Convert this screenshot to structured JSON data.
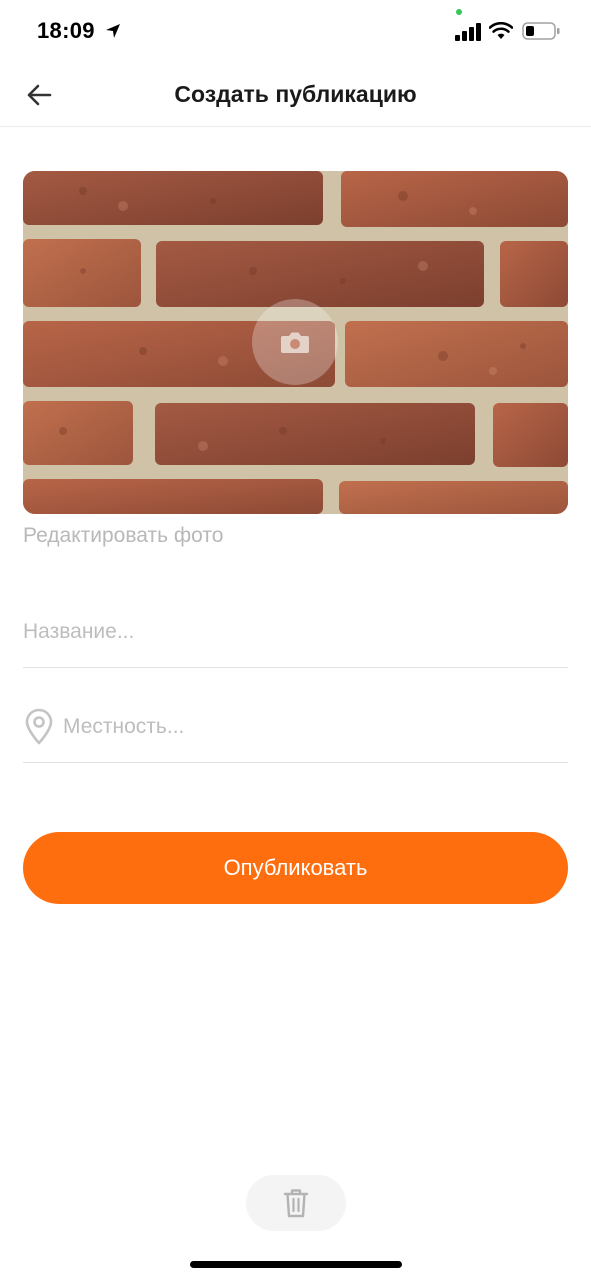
{
  "status_bar": {
    "time": "18:09",
    "icons": [
      "location-arrow-icon",
      "signal-icon",
      "wifi-icon",
      "battery-icon"
    ],
    "camera_indicator_color": "#34c759"
  },
  "header": {
    "title": "Создать публикацию",
    "back_icon": "arrow-left-icon"
  },
  "photo": {
    "overlay_icon": "camera-icon",
    "edit_label": "Редактировать фото"
  },
  "form": {
    "name_placeholder": "Название...",
    "place_placeholder": "Местность...",
    "place_icon": "location-pin-icon"
  },
  "actions": {
    "publish_label": "Опубликовать",
    "delete_icon": "trash-icon"
  },
  "colors": {
    "accent": "#ff6e0e",
    "placeholder": "#bdbdbd",
    "background": "#ffffff"
  }
}
